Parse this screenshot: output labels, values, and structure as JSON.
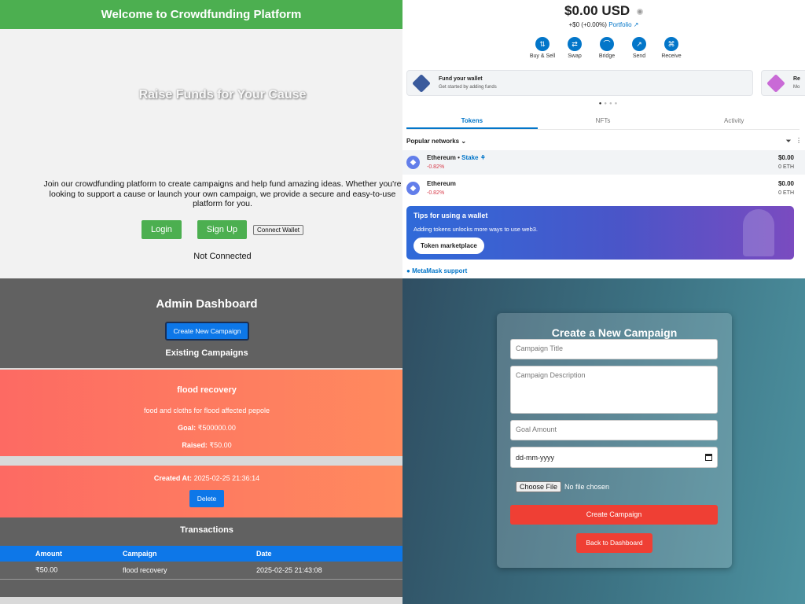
{
  "crowdfunding": {
    "header_title": "Welcome to Crowdfunding Platform",
    "hero_title": "Raise Funds for Your Cause",
    "intro_text": "Join our crowdfunding platform to create campaigns and help fund amazing ideas. Whether you're looking to support a cause or launch your own campaign, we provide a secure and easy-to-use platform for you.",
    "login_label": "Login",
    "signup_label": "Sign Up",
    "connect_wallet_label": "Connect Wallet",
    "connection_status": "Not Connected",
    "colors": {
      "header": "#4caf50",
      "button": "#4caf50"
    }
  },
  "wallet": {
    "balance": "$0.00",
    "currency": "USD",
    "change": "+$0 (+0.00%)",
    "portfolio_link": "Portfolio",
    "actions": [
      {
        "label": "Buy & Sell",
        "icon": "buy-sell-icon",
        "glyph": "⇅"
      },
      {
        "label": "Swap",
        "icon": "swap-icon",
        "glyph": "⇄"
      },
      {
        "label": "Bridge",
        "icon": "bridge-icon",
        "glyph": "⌒"
      },
      {
        "label": "Send",
        "icon": "send-icon",
        "glyph": "↗"
      },
      {
        "label": "Receive",
        "icon": "receive-icon",
        "glyph": "⌘"
      }
    ],
    "fund_card": {
      "title": "Fund your wallet",
      "subtitle": "Get started by adding funds"
    },
    "second_card": {
      "title": "Re",
      "subtitle": "Mo"
    },
    "tabs": [
      "Tokens",
      "NFTs",
      "Activity"
    ],
    "active_tab": "Tokens",
    "network_filter": "Popular networks",
    "tokens": [
      {
        "name": "Ethereum",
        "stake_label": "Stake",
        "change": "-0.82%",
        "value": "$0.00",
        "amount": "0 ETH"
      },
      {
        "name": "Ethereum",
        "stake_label": "",
        "change": "-0.82%",
        "value": "$0.00",
        "amount": "0 ETH"
      }
    ],
    "tips": {
      "title": "Tips for using a wallet",
      "description": "Adding tokens unlocks more ways to use web3.",
      "button_label": "Token marketplace"
    },
    "support_link": "MetaMask support",
    "colors": {
      "accent": "#0376c9",
      "negative": "#d73847"
    }
  },
  "admin": {
    "title": "Admin Dashboard",
    "create_button_label": "Create New Campaign",
    "existing_heading": "Existing Campaigns",
    "campaign": {
      "name": "flood recovery",
      "description": "food and cloths for flood affected pepole",
      "goal_label": "Goal:",
      "goal_value": "₹500000.00",
      "raised_label": "Raised:",
      "raised_value": "₹50.00",
      "created_label": "Created At:",
      "created_value": "2025-02-25 21:36:14",
      "delete_label": "Delete"
    },
    "transactions_heading": "Transactions",
    "table": {
      "columns": [
        "Amount",
        "Campaign",
        "Date"
      ],
      "rows": [
        [
          "₹50.00",
          "flood recovery",
          "2025-02-25 21:43:08"
        ]
      ]
    },
    "colors": {
      "card": "#fd6a63",
      "primary": "#0d77e8"
    }
  },
  "create_form": {
    "title": "Create a New Campaign",
    "title_placeholder": "Campaign Title",
    "description_placeholder": "Campaign Description",
    "goal_placeholder": "Goal Amount",
    "date_placeholder": "dd-mm-yyyy",
    "file_button_label": "Choose File",
    "file_status": "No file chosen",
    "submit_label": "Create Campaign",
    "back_label": "Back to Dashboard",
    "colors": {
      "button": "#ef3f34"
    }
  }
}
